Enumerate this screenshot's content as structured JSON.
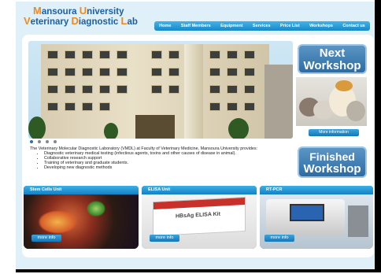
{
  "logo": {
    "line1": [
      "M",
      "ansoura ",
      "U",
      "niversity"
    ],
    "line2": [
      "V",
      "eterinary ",
      "D",
      "iagnostic ",
      "L",
      "ab"
    ]
  },
  "nav": {
    "items": [
      "Home",
      "Staff Members",
      "Equipment",
      "Services",
      "Price List",
      "Workshops",
      "Contact us"
    ]
  },
  "sidebar": {
    "next_line1": "Next",
    "next_line2": "Workshop",
    "more_information": "More information",
    "finished_line1": "Finished",
    "finished_line2": "Workshop"
  },
  "description": {
    "intro": "The Veterinary Molecular Diagnostic Laboratory (VMDL) at Faculty of Veterinary Medicine, Mansoura University provides:",
    "bullets": [
      "Diagnostic veterinary medical testing (infectious agents, toxins and other causes of disease in animal).",
      "Collaborative research support",
      "Training of veterinary and graduate students.",
      "Developing new diagnostic methods"
    ]
  },
  "cards": [
    {
      "title": "Stem Cells Unit",
      "button": "more info"
    },
    {
      "title": "ELISA Unit",
      "button": "more info",
      "kit_label": "HBsAg ELISA Kit"
    },
    {
      "title": "RT-PCR",
      "button": "more info"
    }
  ],
  "slider": {
    "count": 4,
    "active": 0
  },
  "colors": {
    "brand_blue": "#1c5fa3",
    "accent_orange": "#f08a1c",
    "nav_blue": "#1688c9"
  }
}
